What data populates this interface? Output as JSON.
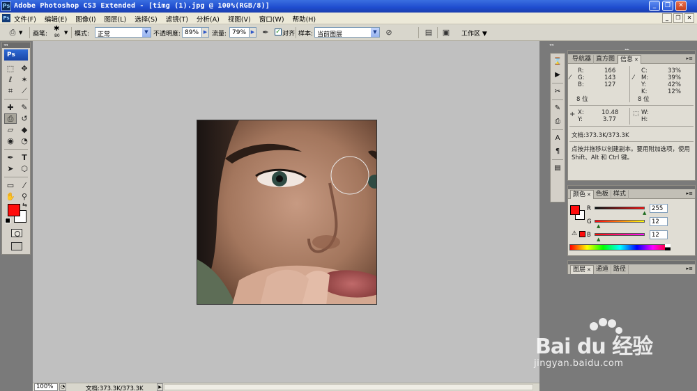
{
  "titlebar": {
    "title": "Adobe Photoshop CS3 Extended - [timg (1).jpg @ 100%(RGB/8)]",
    "app_icon": "Ps",
    "minimize": "_",
    "restore": "❐",
    "close": "✕"
  },
  "menubar": {
    "badge": "Ps",
    "items": [
      "文件(F)",
      "编辑(E)",
      "图像(I)",
      "图层(L)",
      "选择(S)",
      "滤镜(T)",
      "分析(A)",
      "视图(V)",
      "窗口(W)",
      "帮助(H)"
    ],
    "mdi_minimize": "_",
    "mdi_restore": "❐",
    "mdi_close": "✕"
  },
  "options": {
    "brush_label": "画笔:",
    "brush_size": "80",
    "mode_label": "模式:",
    "mode_value": "正常",
    "opacity_label": "不透明度:",
    "opacity_value": "89%",
    "flow_label": "流量:",
    "flow_value": "79%",
    "aligned_label": "对齐",
    "aligned_checked": true,
    "sample_label": "样本:",
    "sample_value": "当前图层",
    "workspace_label": "工作区"
  },
  "toolbox": {
    "logo": "Ps",
    "foreground_color": "#ff0c0c",
    "background_color": "#ffffff"
  },
  "canvas": {
    "background_color": "#c0c0c0"
  },
  "status": {
    "zoom": "100%",
    "doc": "文档:373.3K/373.3K"
  },
  "info_panel": {
    "tabs": [
      "导航器",
      "直方图",
      "信息"
    ],
    "active_tab": "信息",
    "rgb": {
      "R": "166",
      "G": "143",
      "B": "127"
    },
    "cmyk": {
      "C": "33%",
      "M": "39%",
      "Y": "42%",
      "K": "12%"
    },
    "bit_left": "8 位",
    "bit_right": "8 位",
    "X": "10.48",
    "Y": "3.77",
    "W": "",
    "H": "",
    "doc": "文档:373.3K/373.3K",
    "hint": "点按并拖移以创建副本。要用附加选项，使用 Shift、Alt 和 Ctrl 键。"
  },
  "color_panel": {
    "tabs": [
      "颜色",
      "色板",
      "样式"
    ],
    "active_tab": "颜色",
    "R_label": "R",
    "G_label": "G",
    "B_label": "B",
    "R": "255",
    "G": "12",
    "B": "12"
  },
  "layers_panel": {
    "tabs": [
      "图层",
      "通道",
      "路径"
    ],
    "active_tab": "图层"
  },
  "watermark": {
    "brand": "Bai du 经验",
    "site": "jingyan.baidu.com"
  }
}
